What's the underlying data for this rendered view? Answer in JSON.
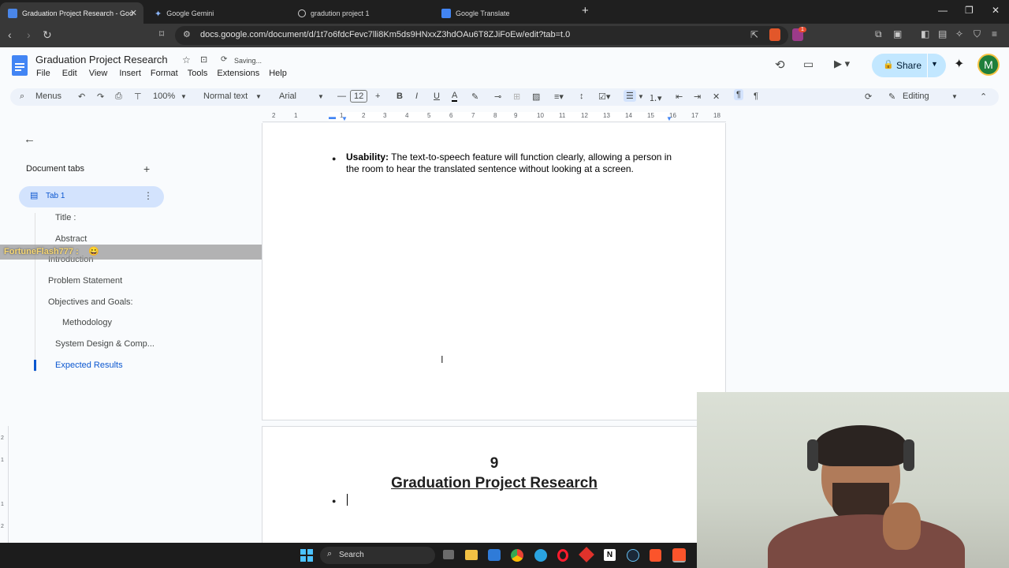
{
  "browser": {
    "tabs": [
      {
        "title": "Graduation Project Research - Goo",
        "active": true
      },
      {
        "title": "Google Gemini",
        "active": false
      },
      {
        "title": "gradution project 1",
        "active": false
      },
      {
        "title": "Google Translate",
        "active": false
      }
    ],
    "new_tab_label": "+",
    "url": "docs.google.com/document/d/1t7o6fdcFevc7lli8Km5ds9HNxxZ3hdOAu6T8ZJiFoEw/edit?tab=t.0",
    "extension_badge": "1"
  },
  "doc": {
    "title": "Graduation Project Research",
    "save_status": "Saving...",
    "menus": [
      "File",
      "Edit",
      "View",
      "Insert",
      "Format",
      "Tools",
      "Extensions",
      "Help"
    ],
    "share_label": "Share",
    "avatar_letter": "M"
  },
  "toolbar": {
    "menus_label": "Menus",
    "zoom": "100%",
    "style": "Normal text",
    "font": "Arial",
    "font_size": "12",
    "mode": "Editing"
  },
  "ruler": {
    "ticks": [
      "2",
      "1",
      "1",
      "2",
      "3",
      "4",
      "5",
      "6",
      "7",
      "8",
      "9",
      "10",
      "11",
      "12",
      "13",
      "14",
      "15",
      "16",
      "17",
      "18"
    ],
    "left_ticks": [
      "2",
      "1",
      "1",
      "2"
    ]
  },
  "sidebar": {
    "heading": "Document tabs",
    "add_label": "+",
    "tab_name": "Tab 1",
    "outline": [
      {
        "label": "Title :",
        "indent": 1,
        "active": false
      },
      {
        "label": "Abstract",
        "indent": 1,
        "active": false
      },
      {
        "label": "Introduction",
        "indent": 0,
        "active": false
      },
      {
        "label": "Problem Statement",
        "indent": 0,
        "active": false
      },
      {
        "label": "Objectives and Goals:",
        "indent": 0,
        "active": false
      },
      {
        "label": "Methodology",
        "indent": 2,
        "active": false
      },
      {
        "label": "System Design & Comp...",
        "indent": 1,
        "active": false
      },
      {
        "label": "Expected Results",
        "indent": 1,
        "active": true
      }
    ]
  },
  "overlay": {
    "chat_user": "FortuneFlash777 :",
    "chat_emoji": "😀"
  },
  "page1": {
    "bullet_bold": "Usability:",
    "bullet_text": " The text-to-speech feature will function clearly, allowing a person in the room to hear the translated sentence without looking at a screen."
  },
  "page2": {
    "page_number": "9",
    "heading": "Graduation Project Research"
  },
  "taskbar": {
    "search_label": "Search"
  }
}
